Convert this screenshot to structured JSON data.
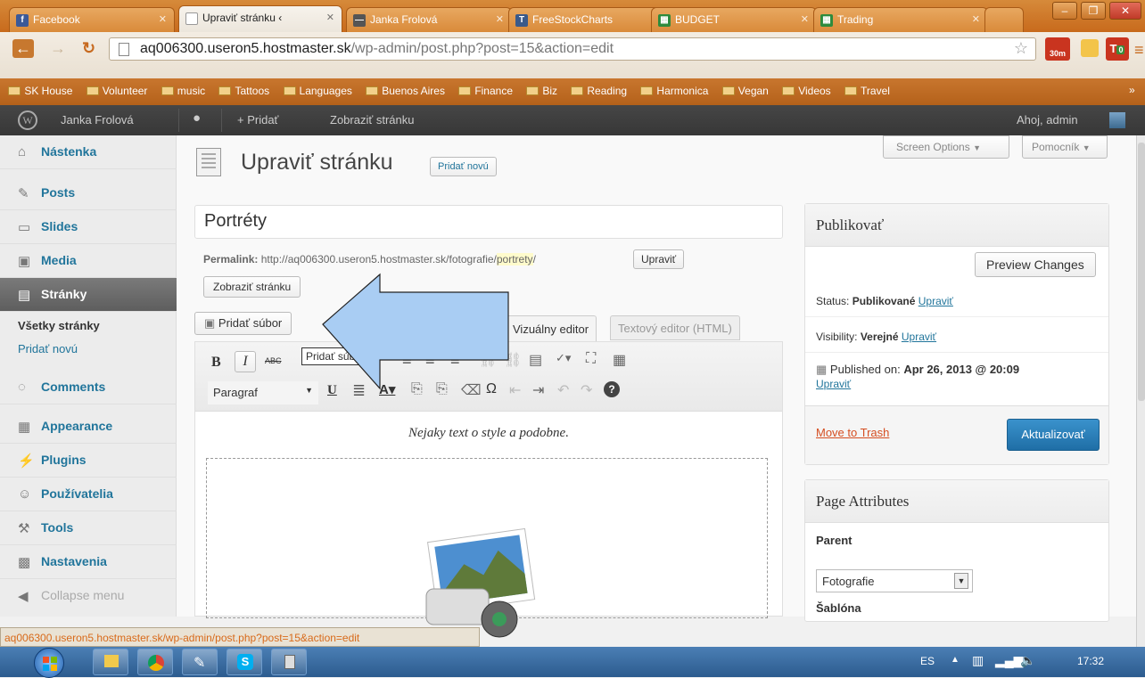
{
  "browser": {
    "tabs": [
      {
        "label": "Facebook",
        "icon": "f",
        "color": "#3b5998"
      },
      {
        "label": "Upraviť stránku ‹",
        "icon": "doc",
        "color": "#888888"
      },
      {
        "label": "Janka Frolová",
        "icon": "—",
        "color": "#555555"
      },
      {
        "label": "FreeStockCharts",
        "icon": "T",
        "color": "#3a5a8a"
      },
      {
        "label": "BUDGET",
        "icon": "▦",
        "color": "#2e8b3d"
      },
      {
        "label": "Trading",
        "icon": "▦",
        "color": "#2e8b3d"
      }
    ],
    "url_host": "aq006300.useron5.hostmaster.sk",
    "url_path": "/wp-admin/post.php?post=15&action=edit",
    "ext_badge": "30m",
    "ext_badge2": "0",
    "bookmarks": [
      "SK House",
      "Volunteer",
      "music",
      "Tattoos",
      "Languages",
      "Buenos Aires",
      "Finance",
      "Biz",
      "Reading",
      "Harmonica",
      "Vegan",
      "Videos",
      "Travel"
    ],
    "bookmarks_more": "»",
    "status_url": "aq006300.useron5.hostmaster.sk/wp-admin/post.php?post=15&action=edit"
  },
  "adminbar": {
    "site": "Janka Frolová",
    "new": "+ Pridať",
    "view": "Zobraziť stránku",
    "greeting": "Ahoj, admin"
  },
  "menu": {
    "items": [
      "Nástenka",
      "Posts",
      "Slides",
      "Media",
      "Stránky",
      "Comments",
      "Appearance",
      "Plugins",
      "Používatelia",
      "Tools",
      "Nastavenia",
      "Collapse menu"
    ],
    "sub": [
      "Všetky stránky",
      "Pridať novú"
    ]
  },
  "page": {
    "screen_options": "Screen Options",
    "help": "Pomocník",
    "heading": "Upraviť stránku",
    "add_new": "Pridať novú",
    "title_value": "Portréty",
    "permalink_label": "Permalink:",
    "permalink_base": "http://aq006300.useron5.hostmaster.sk/fotografie/",
    "permalink_slug": "portrety",
    "permalink_end": "/",
    "edit_btn": "Upraviť",
    "view_btn": "Zobraziť stránku",
    "add_media": "Pridať súbor",
    "tooltip": "Pridať súbor",
    "tab_visual": "Vizuálny editor",
    "tab_html": "Textový editor (HTML)",
    "format_select": "Paragraf",
    "content_text": "Nejaky text o style a podobne."
  },
  "publish": {
    "title": "Publikovať",
    "preview": "Preview Changes",
    "status_label": "Status:",
    "status_value": "Publikované",
    "edit": "Upraviť",
    "visibility_label": "Visibility:",
    "visibility_value": "Verejné",
    "published_label": "Published on:",
    "published_value": "Apr 26, 2013 @ 20:09",
    "trash": "Move to Trash",
    "update": "Aktualizovať"
  },
  "attributes": {
    "title": "Page Attributes",
    "parent_label": "Parent",
    "parent_value": "Fotografie",
    "template_label": "Šablóna"
  },
  "taskbar": {
    "lang": "ES",
    "time": "17:32"
  },
  "colors": {
    "wp_link": "#21759b",
    "update_button": "#2e7fbf",
    "arrow": "#a9cdf3",
    "trash": "#d54e21"
  }
}
